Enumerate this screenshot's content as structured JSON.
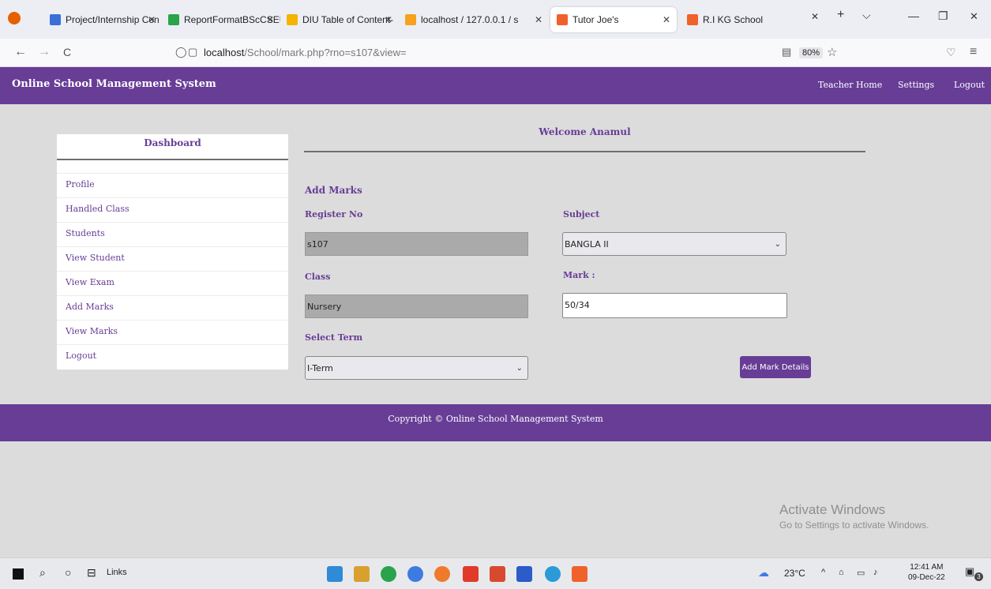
{
  "browser": {
    "tabs": [
      {
        "label": "Project/Internship Con",
        "color": "#3a6fd8"
      },
      {
        "label": "ReportFormatBScCSEU",
        "color": "#2aa34a"
      },
      {
        "label": "DIU Table of Content-",
        "color": "#f4b400"
      },
      {
        "label": "localhost / 127.0.0.1 / s",
        "color": "#f6a21e"
      },
      {
        "label": "Tutor Joe's",
        "color": "#f0622b"
      },
      {
        "label": "R.I KG School",
        "color": "#f0622b"
      }
    ],
    "url_host": "localhost",
    "url_path": "/School/mark.php?rno=s107&view=",
    "zoom": "80%",
    "close_glyph": "✕",
    "newtab_glyph": "+",
    "list_glyph": "⌵",
    "minimize_glyph": "—",
    "restore_glyph": "❐",
    "back_glyph": "←",
    "forward_glyph": "→",
    "reload_glyph": "C",
    "shield_glyph": "◯",
    "page_glyph": "▢",
    "reader_glyph": "▤",
    "star_glyph": "☆",
    "pocket_glyph": "♡",
    "menu_glyph": "≡"
  },
  "app": {
    "title": "Online School Management System",
    "nav": [
      "Teacher Home",
      "Settings",
      "Logout"
    ],
    "sidebar_title": "Dashboard",
    "sidebar_items": [
      "Profile",
      "Handled Class",
      "Students",
      "View Student",
      "View Exam",
      "Add Marks",
      "View Marks",
      "Logout"
    ],
    "welcome": "Welcome Anamul",
    "form": {
      "heading": "Add Marks",
      "register_label": "Register No",
      "register_value": "s107",
      "class_label": "Class",
      "class_value": "Nursery",
      "term_label": "Select Term",
      "term_value": "I-Term",
      "subject_label": "Subject",
      "subject_value": "BANGLA II",
      "mark_label": "Mark :",
      "mark_value": "50/34",
      "submit_label": "Add Mark Details"
    },
    "footer": "Copyright © Online School Management System"
  },
  "watermark": {
    "line1": "Activate Windows",
    "line2": "Go to Settings to activate Windows."
  },
  "taskbar": {
    "links_label": "Links",
    "temp": "23°C",
    "time": "12:41 AM",
    "date": "09-Dec-22",
    "notif_count": "3",
    "icon_colors": [
      "#2f8ad8",
      "#d8a12f",
      "#2aa34a",
      "#3d7be0",
      "#f07a2b",
      "#e03a2a",
      "#d84a2f",
      "#2b5cc8",
      "#2a9ad8",
      "#f0622b"
    ]
  }
}
